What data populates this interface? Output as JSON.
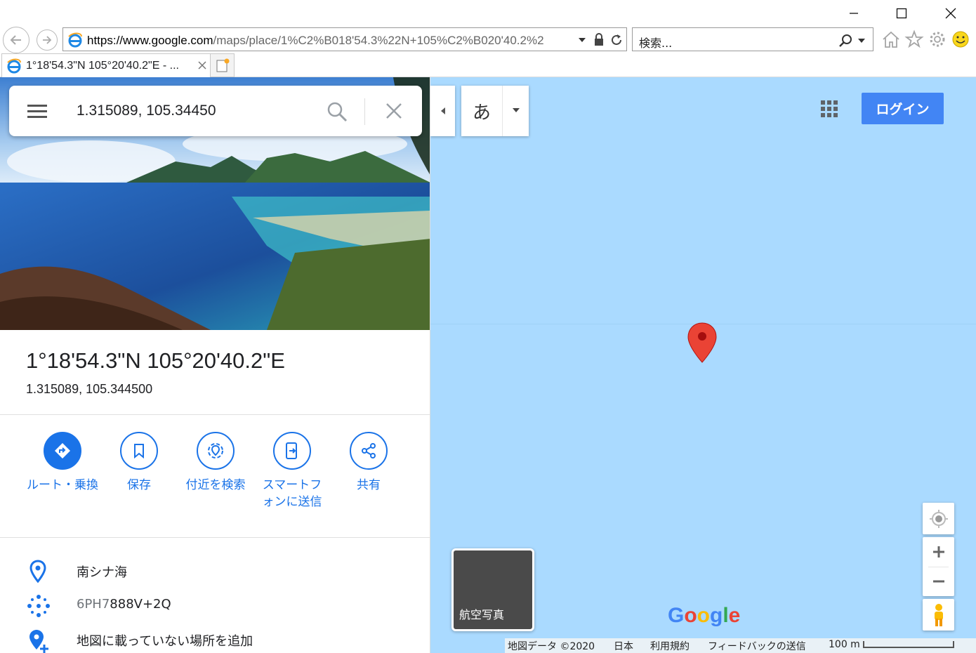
{
  "browser": {
    "url_host_part": "https://www.google.com",
    "url_rest": "/maps/place/1%C2%B018'54.3%22N+105%C2%B020'40.2%2",
    "search_placeholder": "検索...",
    "tab_title": "1°18'54.3\"N 105°20'40.2\"E - ..."
  },
  "search": {
    "value": "1.315089, 105.34450"
  },
  "place": {
    "title": "1°18'54.3\"N 105°20'40.2\"E",
    "coords": "1.315089, 105.344500"
  },
  "actions": [
    {
      "label": "ルート・乗換",
      "icon": "directions-icon"
    },
    {
      "label": "保存",
      "icon": "bookmark-icon"
    },
    {
      "label": "付近を検索",
      "icon": "nearby-icon"
    },
    {
      "label": "スマートフォンに送信",
      "icon": "send-to-phone-icon"
    },
    {
      "label": "共有",
      "icon": "share-icon"
    }
  ],
  "info": {
    "region": "南シナ海",
    "pluscode_prefix": "6PH7",
    "pluscode_main": "888V+2Q",
    "add_missing": "地図に載っていない場所を追加"
  },
  "map": {
    "ime_label": "あ",
    "login_label": "ログイン",
    "satellite_label": "航空写真",
    "footer": {
      "map_data": "地図データ ©2020",
      "country": "日本",
      "terms": "利用規約",
      "feedback": "フィードバックの送信",
      "scale": "100 m"
    }
  },
  "colors": {
    "accent": "#1a73e8",
    "login_button": "#4285f4",
    "ocean": "#aadaff",
    "pin": "#ea4335"
  }
}
